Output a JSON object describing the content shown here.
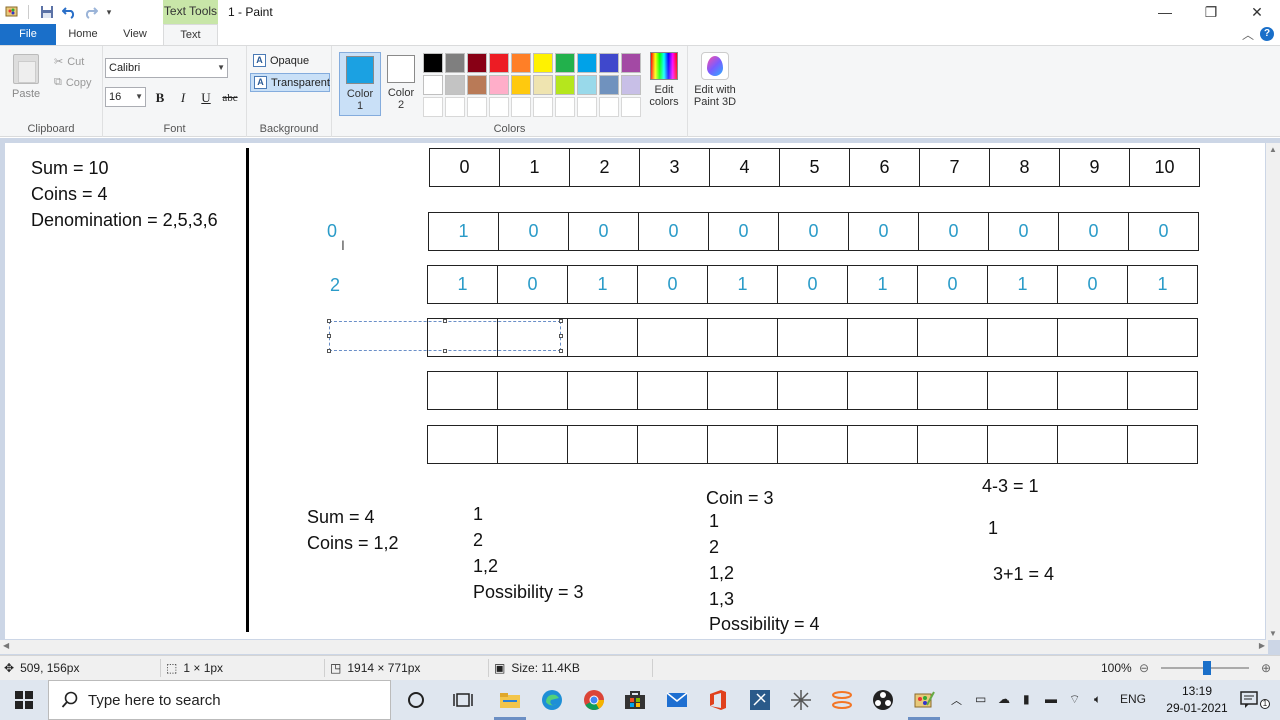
{
  "titlebar": {
    "context_tab": "Text Tools",
    "title": "1 - Paint"
  },
  "tabs": {
    "file": "File",
    "home": "Home",
    "view": "View",
    "text": "Text"
  },
  "ribbon": {
    "clipboard": {
      "paste": "Paste",
      "cut": "Cut",
      "copy": "Copy",
      "group": "Clipboard"
    },
    "font": {
      "name": "Calibri",
      "size": "16",
      "bold": "B",
      "italic": "I",
      "underline": "U",
      "strike": "abc",
      "group": "Font"
    },
    "background": {
      "opaque": "Opaque",
      "transparent": "Transparent",
      "group": "Background"
    },
    "colors": {
      "color1_label": "Color",
      "color1_num": "1",
      "color2_label": "Color",
      "color2_num": "2",
      "color1": "#1ba1e2",
      "color2": "#ffffff",
      "edit_colors": "Edit",
      "edit_colors2": "colors",
      "group": "Colors",
      "palette": [
        "#000000",
        "#7f7f7f",
        "#880015",
        "#ed1c24",
        "#ff7f27",
        "#fff200",
        "#22b14c",
        "#00a2e8",
        "#3f48cc",
        "#a349a4",
        "#ffffff",
        "#c3c3c3",
        "#b97a57",
        "#ffaec9",
        "#ffc90e",
        "#efe4b0",
        "#b5e61d",
        "#99d9ea",
        "#7092be",
        "#c8bfe7",
        "#ffffff",
        "#ffffff",
        "#ffffff",
        "#ffffff",
        "#ffffff",
        "#ffffff",
        "#ffffff",
        "#ffffff",
        "#ffffff",
        "#ffffff"
      ]
    },
    "paint3d": {
      "line1": "Edit with",
      "line2": "Paint 3D"
    }
  },
  "canvas": {
    "left_notes": [
      "Sum = 10",
      "Coins = 4",
      "Denomination = 2,5,3,6"
    ],
    "header_row": [
      "0",
      "1",
      "2",
      "3",
      "4",
      "5",
      "6",
      "7",
      "8",
      "9",
      "10"
    ],
    "row_labels": [
      "0",
      "2"
    ],
    "row0": [
      "1",
      "0",
      "0",
      "0",
      "0",
      "0",
      "0",
      "0",
      "0",
      "0",
      "0"
    ],
    "row1": [
      "1",
      "0",
      "1",
      "0",
      "1",
      "0",
      "1",
      "0",
      "1",
      "0",
      "1"
    ],
    "bottom_a": [
      "Sum = 4",
      "Coins = 1,2"
    ],
    "bottom_b": [
      "1",
      "2",
      "1,2",
      "Possibility = 3"
    ],
    "bottom_c": [
      "Coin = 3",
      "1",
      "2",
      "1,2",
      "1,3",
      "Possibility = 4"
    ],
    "bottom_d": [
      "4-3 = 1",
      "1",
      "3+1 = 4"
    ]
  },
  "status": {
    "cursor_pos": "509, 156px",
    "selection": "1 × 1px",
    "image_size": "1914 × 771px",
    "file_size": "Size: 11.4KB",
    "zoom": "100%"
  },
  "taskbar": {
    "search_placeholder": "Type here to search",
    "lang": "ENG",
    "time": "13:19",
    "date": "29-01-2021"
  }
}
